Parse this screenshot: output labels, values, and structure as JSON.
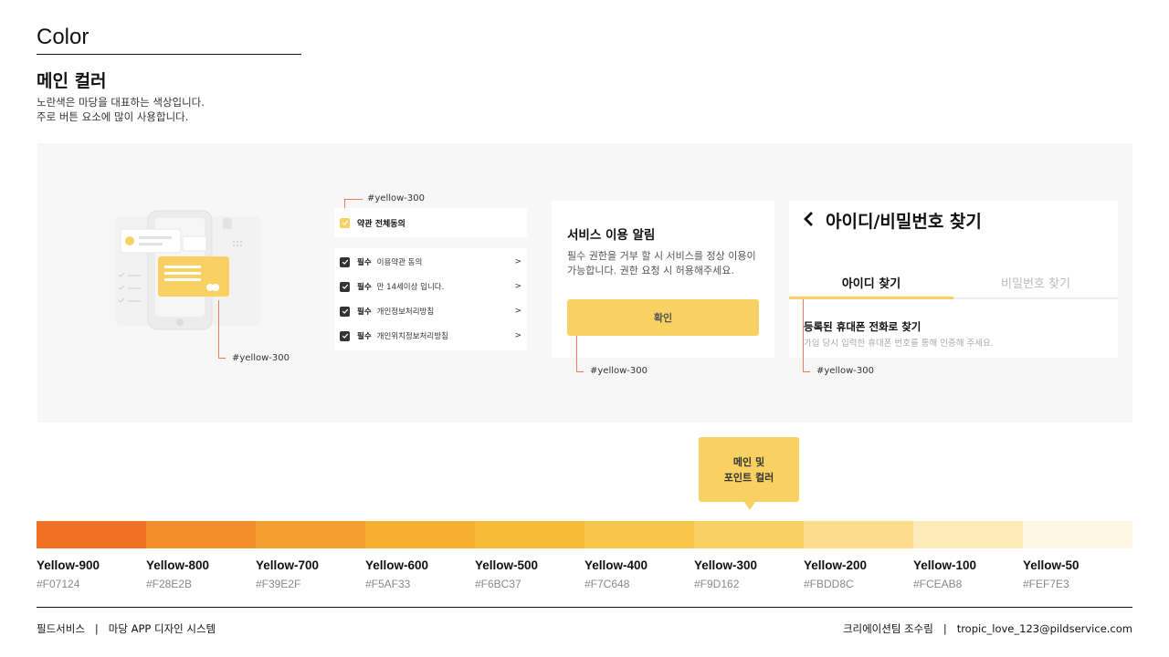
{
  "header": {
    "section_title": "Color",
    "subtitle": "메인 컬러",
    "desc_line1": "노란색은 마당을 대표하는 색상입니다.",
    "desc_line2": "주로 버튼 요소에 많이 사용합니다."
  },
  "annotations": {
    "illustration": "#yellow-300",
    "checkbox": "#yellow-300",
    "dialog": "#yellow-300",
    "find_id": "#yellow-300"
  },
  "checkbox_card": {
    "all_agree": "약관 전체동의",
    "items": [
      {
        "req": "필수",
        "text": "이용약관 동의",
        "arrow": ">"
      },
      {
        "req": "필수",
        "text": "만 14세이상 입니다.",
        "arrow": ">"
      },
      {
        "req": "필수",
        "text": "개인정보처리방침",
        "arrow": ">"
      },
      {
        "req": "필수",
        "text": "개인위치정보처리방침",
        "arrow": ">"
      }
    ]
  },
  "dialog": {
    "title": "서비스 이용 알림",
    "body": "필수 권한을 거부 할 시 서비스를 정상 이용이 가능합니다. 권한 요청 시 허용해주세요.",
    "confirm": "확인"
  },
  "find_id": {
    "title": "아이디/비밀번호 찾기",
    "tab_id": "아이디 찾기",
    "tab_pw": "비밀번호 찾기",
    "sub": "등록된 휴대폰 전화로 찾기",
    "note": "가입 당시 입력한 휴대폰 번호를 통해 인증해 주세요."
  },
  "tooltip": {
    "line1": "메인 및",
    "line2": "포인트 컬러"
  },
  "palette": [
    {
      "name": "Yellow-900",
      "hex": "#F07124"
    },
    {
      "name": "Yellow-800",
      "hex": "#F28E2B"
    },
    {
      "name": "Yellow-700",
      "hex": "#F39E2F"
    },
    {
      "name": "Yellow-600",
      "hex": "#F5AF33"
    },
    {
      "name": "Yellow-500",
      "hex": "#F6BC37"
    },
    {
      "name": "Yellow-400",
      "hex": "#F7C648"
    },
    {
      "name": "Yellow-300",
      "hex": "#F9D162"
    },
    {
      "name": "Yellow-200",
      "hex": "#FBDD8C"
    },
    {
      "name": "Yellow-100",
      "hex": "#FCEAB8"
    },
    {
      "name": "Yellow-50",
      "hex": "#FEF7E3"
    }
  ],
  "footer": {
    "company": "필드서비스",
    "project": "마당 APP 디자인 시스템",
    "team": "크리에이션팀 조수림",
    "email": "tropic_love_123@pildservice.com"
  }
}
